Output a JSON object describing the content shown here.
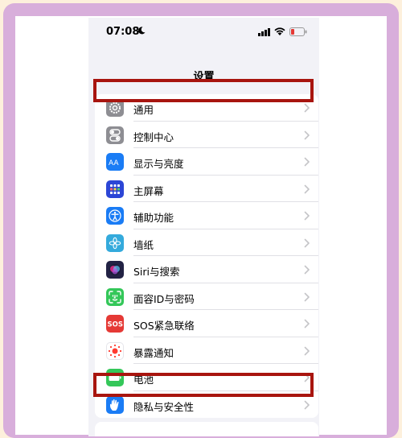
{
  "status_bar": {
    "time": "07:08",
    "moon_icon": "moon-icon",
    "signal_icon": "cellular-signal-icon",
    "wifi_icon": "wifi-icon",
    "battery_icon": "battery-low-icon",
    "battery_color": "#e53935"
  },
  "nav": {
    "title": "设置"
  },
  "settings_items": [
    {
      "label": "通用",
      "icon": "gear-icon",
      "color": "#8e8e93",
      "highlighted": true
    },
    {
      "label": "控制中心",
      "icon": "toggles-icon",
      "color": "#8e8e93"
    },
    {
      "label": "显示与亮度",
      "icon": "text-size-icon",
      "color": "#1a7cf5",
      "icon_text": "AA"
    },
    {
      "label": "主屏幕",
      "icon": "home-grid-icon",
      "color": "#2c46d6"
    },
    {
      "label": "辅助功能",
      "icon": "accessibility-icon",
      "color": "#1a7cf5"
    },
    {
      "label": "墙纸",
      "icon": "flower-icon",
      "color": "#34aadc"
    },
    {
      "label": "Siri与搜索",
      "icon": "siri-icon",
      "color": "#222244"
    },
    {
      "label": "面容ID与密码",
      "icon": "face-id-icon",
      "color": "#34c759"
    },
    {
      "label": "SOS紧急联络",
      "icon": "sos-icon",
      "color": "#e53935",
      "icon_text": "SOS"
    },
    {
      "label": "暴露通知",
      "icon": "exposure-icon",
      "color": "#ffffff"
    },
    {
      "label": "电池",
      "icon": "battery-icon",
      "color": "#34c759"
    },
    {
      "label": "隐私与安全性",
      "icon": "hand-icon",
      "color": "#1a7cf5",
      "highlighted": true
    }
  ],
  "colors": {
    "highlight_border": "#a8150f",
    "frame_purple": "#d8aedb",
    "page_background": "#fdf0dc"
  }
}
